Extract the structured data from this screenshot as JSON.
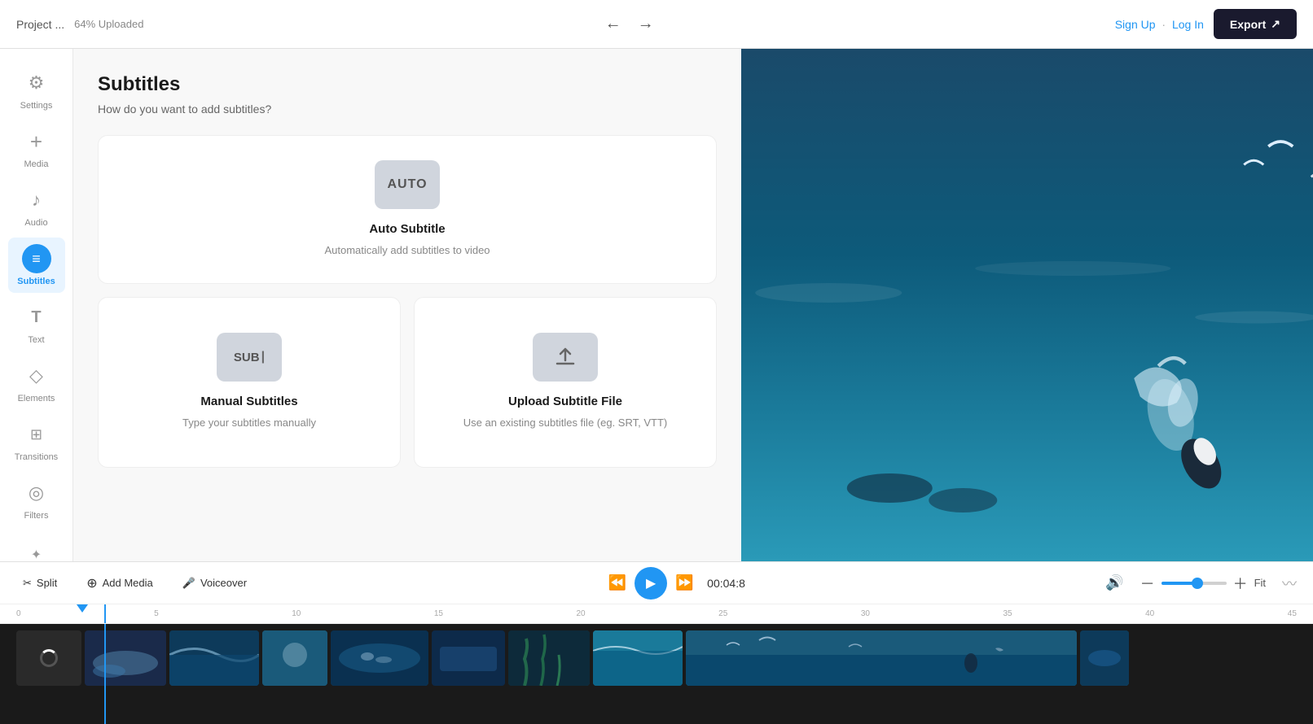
{
  "topbar": {
    "project_name": "Project ...",
    "upload_status": "64% Uploaded",
    "undo_label": "↩",
    "redo_label": "↪",
    "sign_up_label": "Sign Up",
    "log_in_label": "Log In",
    "auth_sep": "·",
    "export_label": "Export"
  },
  "sidebar": {
    "items": [
      {
        "id": "settings",
        "label": "Settings",
        "icon": "⚙"
      },
      {
        "id": "media",
        "label": "Media",
        "icon": "+"
      },
      {
        "id": "audio",
        "label": "Audio",
        "icon": "♪"
      },
      {
        "id": "subtitles",
        "label": "Subtitles",
        "icon": "≡",
        "active": true
      },
      {
        "id": "text",
        "label": "Text",
        "icon": "T"
      },
      {
        "id": "elements",
        "label": "Elements",
        "icon": "◇"
      },
      {
        "id": "transitions",
        "label": "Transitions",
        "icon": "⊞"
      },
      {
        "id": "filters",
        "label": "Filters",
        "icon": "◎"
      }
    ]
  },
  "subtitles_panel": {
    "title": "Subtitles",
    "subtitle": "How do you want to add subtitles?",
    "auto": {
      "icon_text": "AUTO",
      "title": "Auto Subtitle",
      "description": "Automatically add subtitles to video"
    },
    "manual": {
      "icon_text": "SUB|",
      "title": "Manual Subtitles",
      "description": "Type your subtitles manually"
    },
    "upload": {
      "icon_text": "↑",
      "title": "Upload Subtitle File",
      "description": "Use an existing subtitles file (eg. SRT, VTT)"
    }
  },
  "timeline": {
    "split_label": "Split",
    "add_media_label": "Add Media",
    "voiceover_label": "Voiceover",
    "time_display": "00:04:8",
    "fit_label": "Fit",
    "ruler_marks": [
      "0",
      "5",
      "10",
      "15",
      "20",
      "25",
      "30",
      "35",
      "40",
      "45"
    ]
  },
  "colors": {
    "accent": "#2196f3",
    "sidebar_active_bg": "#e8f4ff",
    "export_btn_bg": "#1a1a2e"
  }
}
